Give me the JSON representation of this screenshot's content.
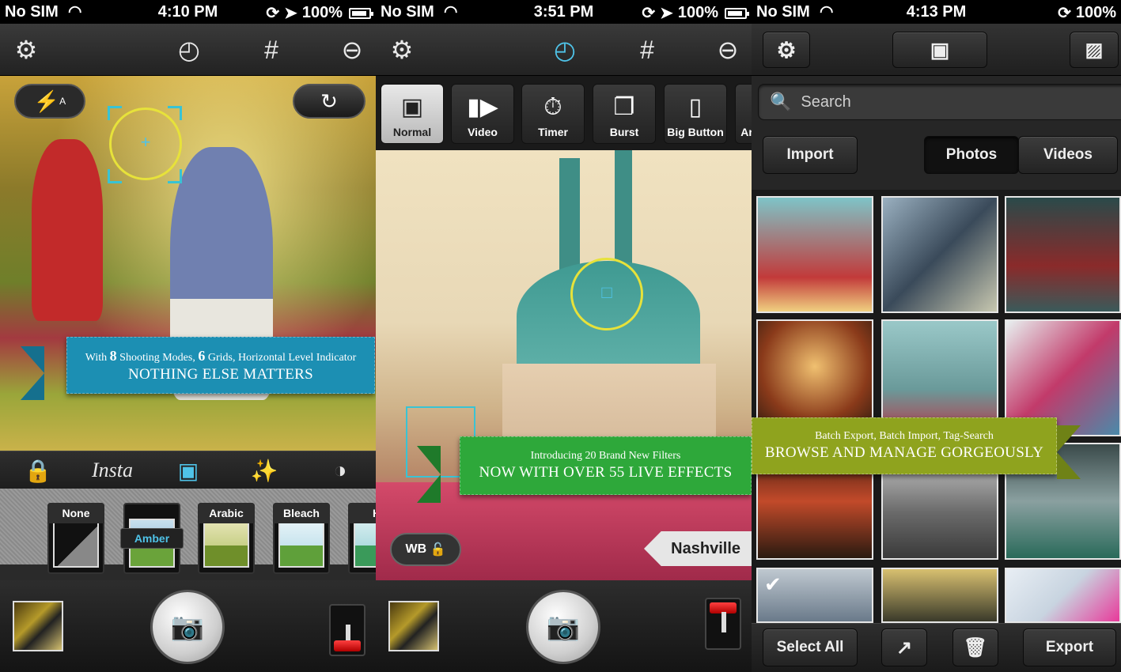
{
  "panels": [
    {
      "status": {
        "carrier": "No SIM",
        "time": "4:10 PM",
        "battery": "100%"
      },
      "ribbon": {
        "prefix_a": "With ",
        "num_a": "8",
        "mid_a": " Shooting Modes, ",
        "num_b": "6",
        "suffix_b": " Grids, Horizontal Level Indicator",
        "title": "NOTHING ELSE MATTERS",
        "color": "#1c8fb3"
      },
      "filterbar": {
        "insta_label": "Insta"
      },
      "filters": [
        {
          "name": "None"
        },
        {
          "name": "Amber",
          "selected_label": "Amber"
        },
        {
          "name": "Arabic"
        },
        {
          "name": "Bleach"
        },
        {
          "name": "H"
        }
      ]
    },
    {
      "status": {
        "carrier": "No SIM",
        "time": "3:51 PM",
        "battery": "100%"
      },
      "modes": [
        {
          "label": "Normal",
          "icon": "camera-icon"
        },
        {
          "label": "Video",
          "icon": "video-camera-icon"
        },
        {
          "label": "Timer",
          "icon": "stopwatch-icon"
        },
        {
          "label": "Burst",
          "icon": "stacked-photos-icon"
        },
        {
          "label": "Big Button",
          "icon": "phone-touch-icon"
        },
        {
          "label": "Ar",
          "icon": "partial-icon"
        }
      ],
      "ribbon": {
        "subtitle": "Introducing 20 Brand New Filters",
        "title": "NOW WITH OVER 55 LIVE EFFECTS",
        "color": "#2ea83a"
      },
      "wb_label": "WB",
      "filter_tag": "Nashville"
    },
    {
      "status": {
        "carrier": "No SIM",
        "time": "4:13 PM",
        "battery": "100%"
      },
      "search": {
        "placeholder": "Search"
      },
      "import_label": "Import",
      "tabs": [
        {
          "label": "Photos",
          "active": true
        },
        {
          "label": "Videos",
          "active": false
        }
      ],
      "ribbon": {
        "subtitle": "Batch Export, Batch Import, Tag-Search",
        "title": "BROWSE AND MANAGE GORGEOUSLY",
        "color": "#8fa31e"
      },
      "bottom": {
        "select_all": "Select All",
        "export": "Export"
      }
    }
  ],
  "accent": "#4fc3e8"
}
